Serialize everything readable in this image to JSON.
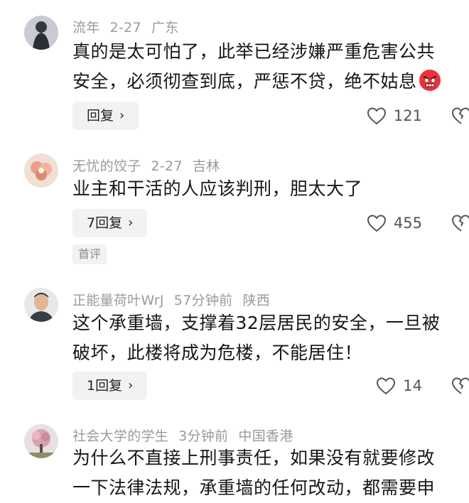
{
  "comments": [
    {
      "username": "流年",
      "date": "2-27",
      "location": "广东",
      "lines": [
        "真的是太可怕了，此举已经涉嫌严重危害公共",
        "安全，必须彻查到底，严惩不贷，绝不姑息"
      ],
      "emoji": "angry-face-emoji",
      "reply_label": "回复",
      "likes": "121"
    },
    {
      "username": "无忧的饺子",
      "date": "2-27",
      "location": "吉林",
      "lines": [
        "业主和干活的人应该判刑，胆太大了"
      ],
      "reply_label": "7回复",
      "likes": "455",
      "tag": "首评"
    },
    {
      "username": "正能量荷叶WrJ",
      "date": "57分钟前",
      "location": "陕西",
      "lines": [
        "这个承重墙，支撑着32层居民的安全，一旦被",
        "破坏，此楼将成为危楼，不能居住！"
      ],
      "reply_label": "1回复",
      "likes": "14"
    },
    {
      "username": "社会大学的学生",
      "date": "3分钟前",
      "location": "中国香港",
      "lines": [
        "为什么不直接上刑事责任，如果没有就要修改",
        "一下法律法规，承重墙的任何改动，都需要申"
      ]
    }
  ],
  "icons": {
    "like": "heart-outline-icon",
    "dislike": "broken-heart-icon",
    "reply_chevron": "chevron-right-icon"
  },
  "colors": {
    "meta": "#9a9a9a",
    "text": "#161616",
    "button_bg": "#f2f2f2"
  }
}
